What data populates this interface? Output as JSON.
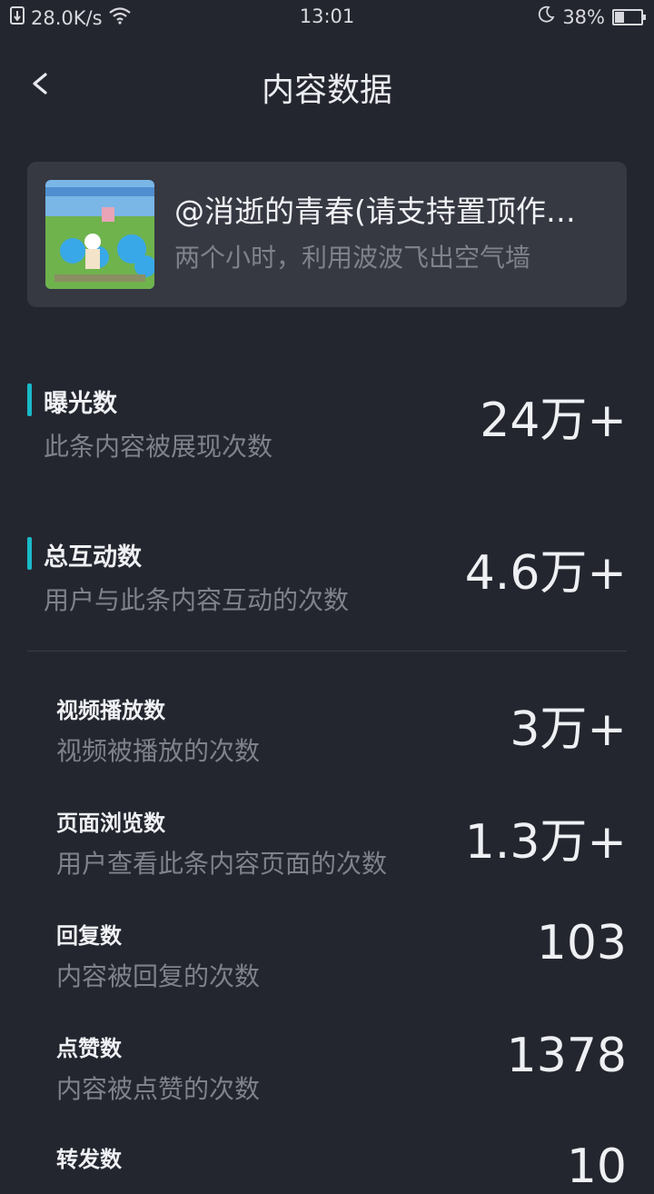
{
  "status_bar": {
    "network_speed": "28.0K/s",
    "time": "13:01",
    "battery_percent": "38%",
    "battery_level": 0.38
  },
  "nav": {
    "title": "内容数据"
  },
  "content": {
    "title": "@消逝的青春(请支持置顶作…",
    "subtitle": "两个小时，利用波波飞出空气墙"
  },
  "primary_metrics": [
    {
      "label": "曝光数",
      "desc": "此条内容被展现次数",
      "value": "24万+"
    },
    {
      "label": "总互动数",
      "desc": "用户与此条内容互动的次数",
      "value": "4.6万+"
    }
  ],
  "sub_metrics": [
    {
      "label": "视频播放数",
      "desc": "视频被播放的次数",
      "value": "3万+"
    },
    {
      "label": "页面浏览数",
      "desc": "用户查看此条内容页面的次数",
      "value": "1.3万+"
    },
    {
      "label": "回复数",
      "desc": "内容被回复的次数",
      "value": "103"
    },
    {
      "label": "点赞数",
      "desc": "内容被点赞的次数",
      "value": "1378"
    },
    {
      "label": "转发数",
      "desc": "",
      "value": "10"
    }
  ],
  "colors": {
    "accent": "#19b9c8",
    "background": "#24262f",
    "card": "#363842"
  }
}
